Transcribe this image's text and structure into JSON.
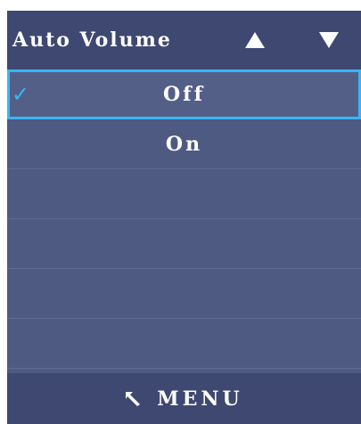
{
  "header": {
    "title": "Auto Volume",
    "up_icon": "triangle-up-icon",
    "down_icon": "triangle-down-icon"
  },
  "menu": {
    "items": [
      {
        "label": "Off",
        "selected": true
      },
      {
        "label": "On",
        "selected": false
      },
      {
        "label": "",
        "selected": false
      },
      {
        "label": "",
        "selected": false
      },
      {
        "label": "",
        "selected": false
      },
      {
        "label": "",
        "selected": false
      }
    ],
    "check_icon": "checkmark-icon"
  },
  "footer": {
    "label": "MENU",
    "back_icon": "return-arrow-icon"
  },
  "colors": {
    "panel": "#4e5a82",
    "header_footer": "#3e4870",
    "selection_border": "#38b6f4",
    "text": "#ffffff"
  }
}
